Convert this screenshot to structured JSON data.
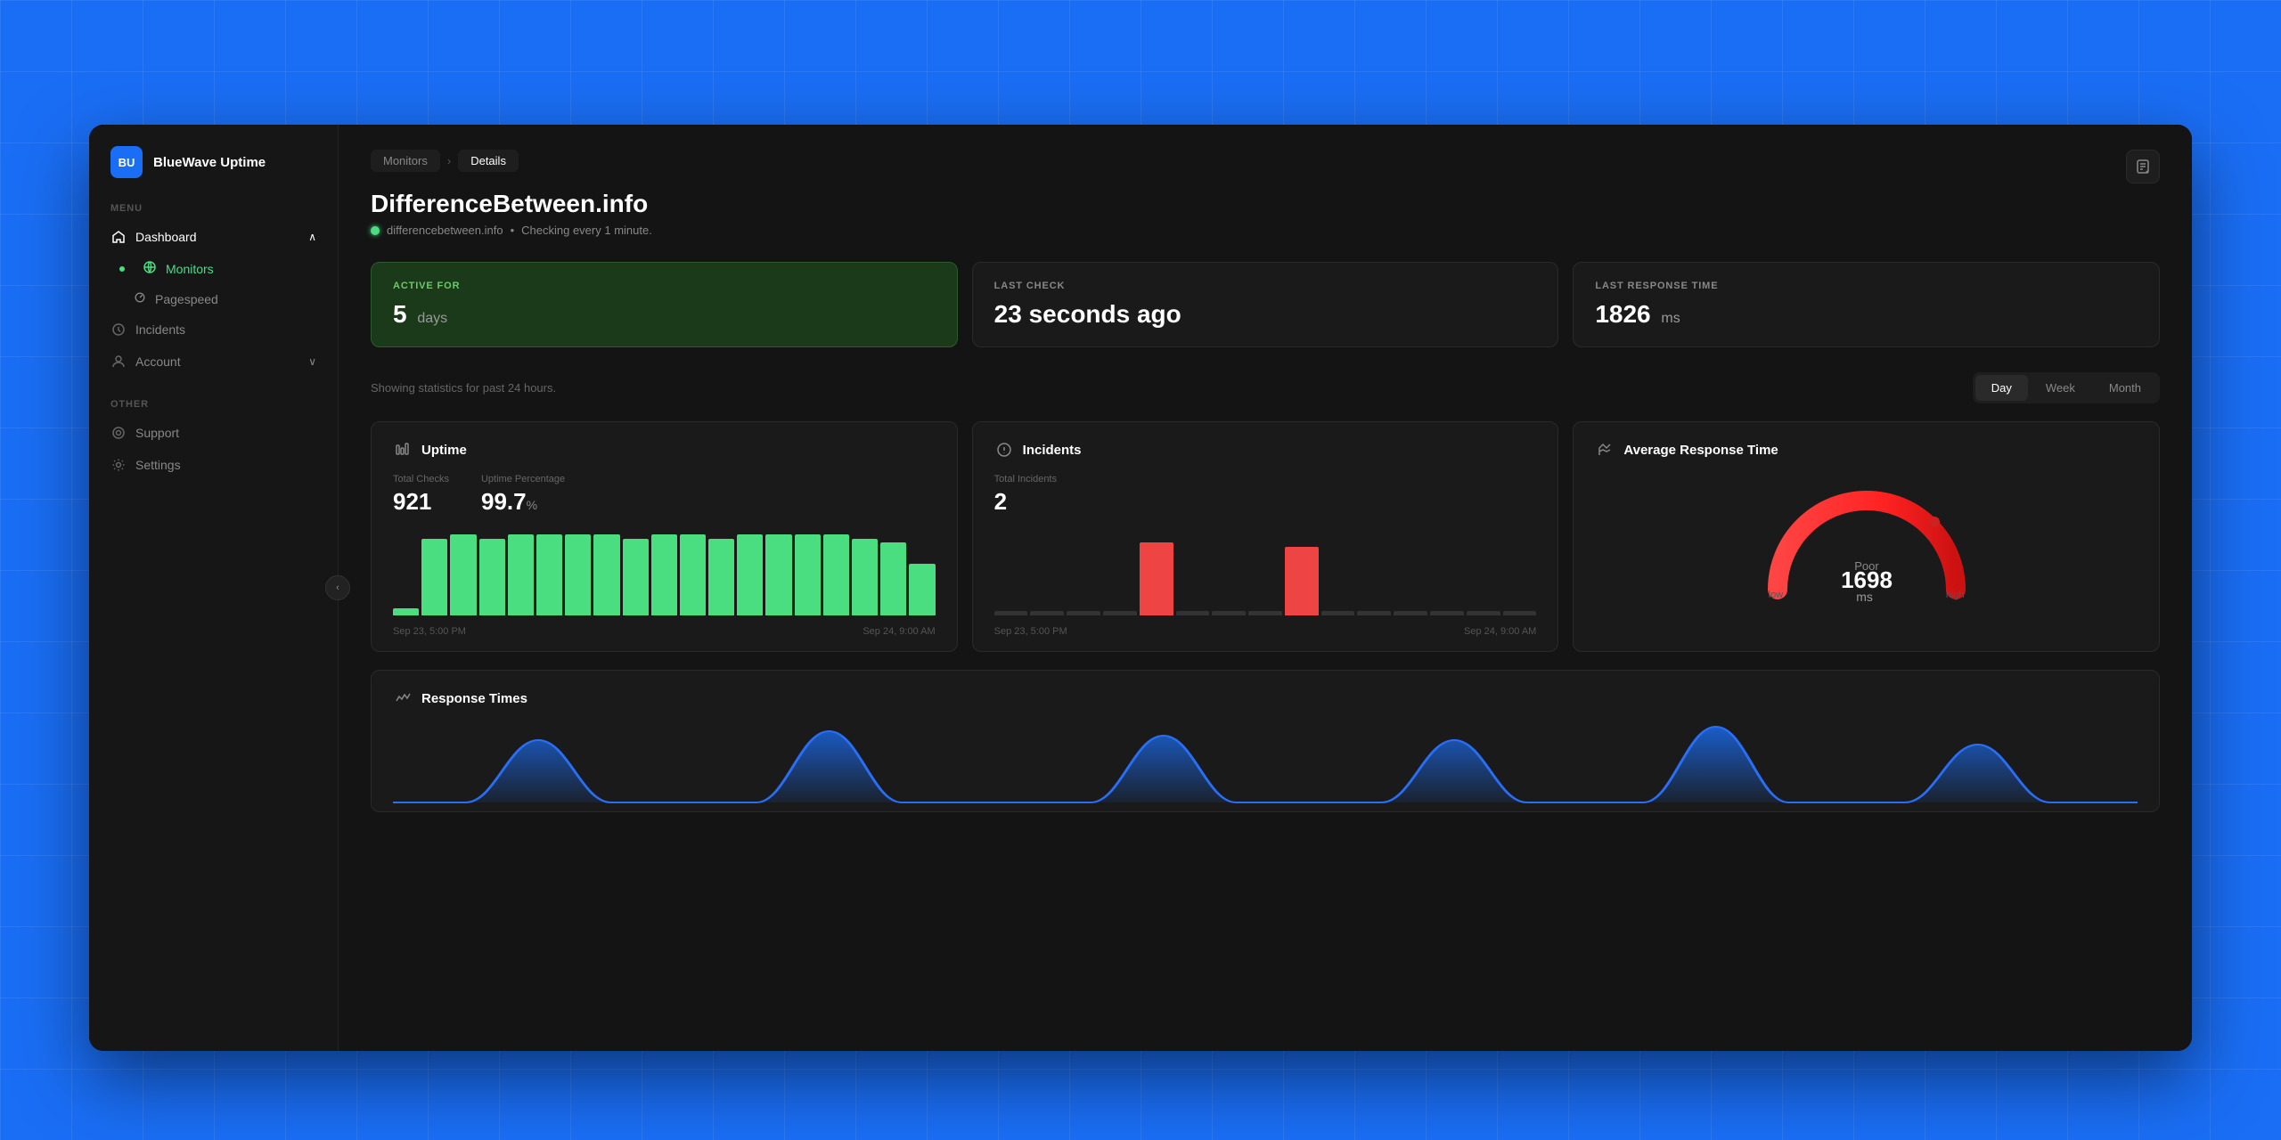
{
  "app": {
    "bg_color": "#1a6ef5",
    "logo_initials": "BU",
    "logo_name": "BlueWave Uptime"
  },
  "sidebar": {
    "menu_label": "MENU",
    "other_label": "OTHER",
    "collapse_icon": "‹",
    "items": [
      {
        "id": "dashboard",
        "label": "Dashboard",
        "icon": "house",
        "active": true,
        "has_chevron": true
      },
      {
        "id": "monitors",
        "label": "Monitors",
        "icon": "globe",
        "active": true,
        "is_sub": false
      },
      {
        "id": "pagespeed",
        "label": "Pagespeed",
        "icon": "gauge",
        "active": false,
        "is_sub": true
      },
      {
        "id": "incidents",
        "label": "Incidents",
        "icon": "clock",
        "active": false
      },
      {
        "id": "account",
        "label": "Account",
        "icon": "user",
        "active": false,
        "has_chevron": true
      }
    ],
    "other_items": [
      {
        "id": "support",
        "label": "Support",
        "icon": "circle"
      },
      {
        "id": "settings",
        "label": "Settings",
        "icon": "gear"
      }
    ]
  },
  "breadcrumb": {
    "items": [
      {
        "label": "Monitors",
        "active": false
      },
      {
        "label": "Details",
        "active": true
      }
    ]
  },
  "page": {
    "title": "DifferenceBetween.info",
    "url": "differencebetween.info",
    "check_interval": "Checking every 1 minute.",
    "status": "online"
  },
  "stats": {
    "active_for": {
      "label": "ACTIVE FOR",
      "value": "5",
      "unit": "days"
    },
    "last_check": {
      "label": "LAST CHECK",
      "value": "23 seconds ago"
    },
    "last_response": {
      "label": "LAST RESPONSE TIME",
      "value": "1826",
      "unit": "ms"
    }
  },
  "period": {
    "showing_text": "Showing statistics for past 24 hours.",
    "buttons": [
      {
        "label": "Day",
        "active": true
      },
      {
        "label": "Week",
        "active": false
      },
      {
        "label": "Month",
        "active": false
      }
    ]
  },
  "uptime_chart": {
    "title": "Uptime",
    "total_checks_label": "Total Checks",
    "total_checks_value": "921",
    "uptime_pct_label": "Uptime Percentage",
    "uptime_pct_value": "99.7",
    "uptime_unit": "%",
    "date_start": "Sep 23, 5:00 PM",
    "date_end": "Sep 24, 9:00 AM",
    "bars": [
      8,
      90,
      95,
      90,
      95,
      95,
      95,
      95,
      90,
      95,
      95,
      90,
      95,
      95,
      95,
      95,
      90,
      85,
      60
    ]
  },
  "incidents_chart": {
    "title": "Incidents",
    "total_label": "Total Incidents",
    "total_value": "2",
    "date_start": "Sep 23, 5:00 PM",
    "date_end": "Sep 24, 9:00 AM"
  },
  "avg_response": {
    "title": "Average Response Time",
    "rating": "Poor",
    "value": "1698",
    "unit": "ms",
    "low_label": "low",
    "high_label": "high"
  },
  "response_times": {
    "title": "Response Times"
  }
}
